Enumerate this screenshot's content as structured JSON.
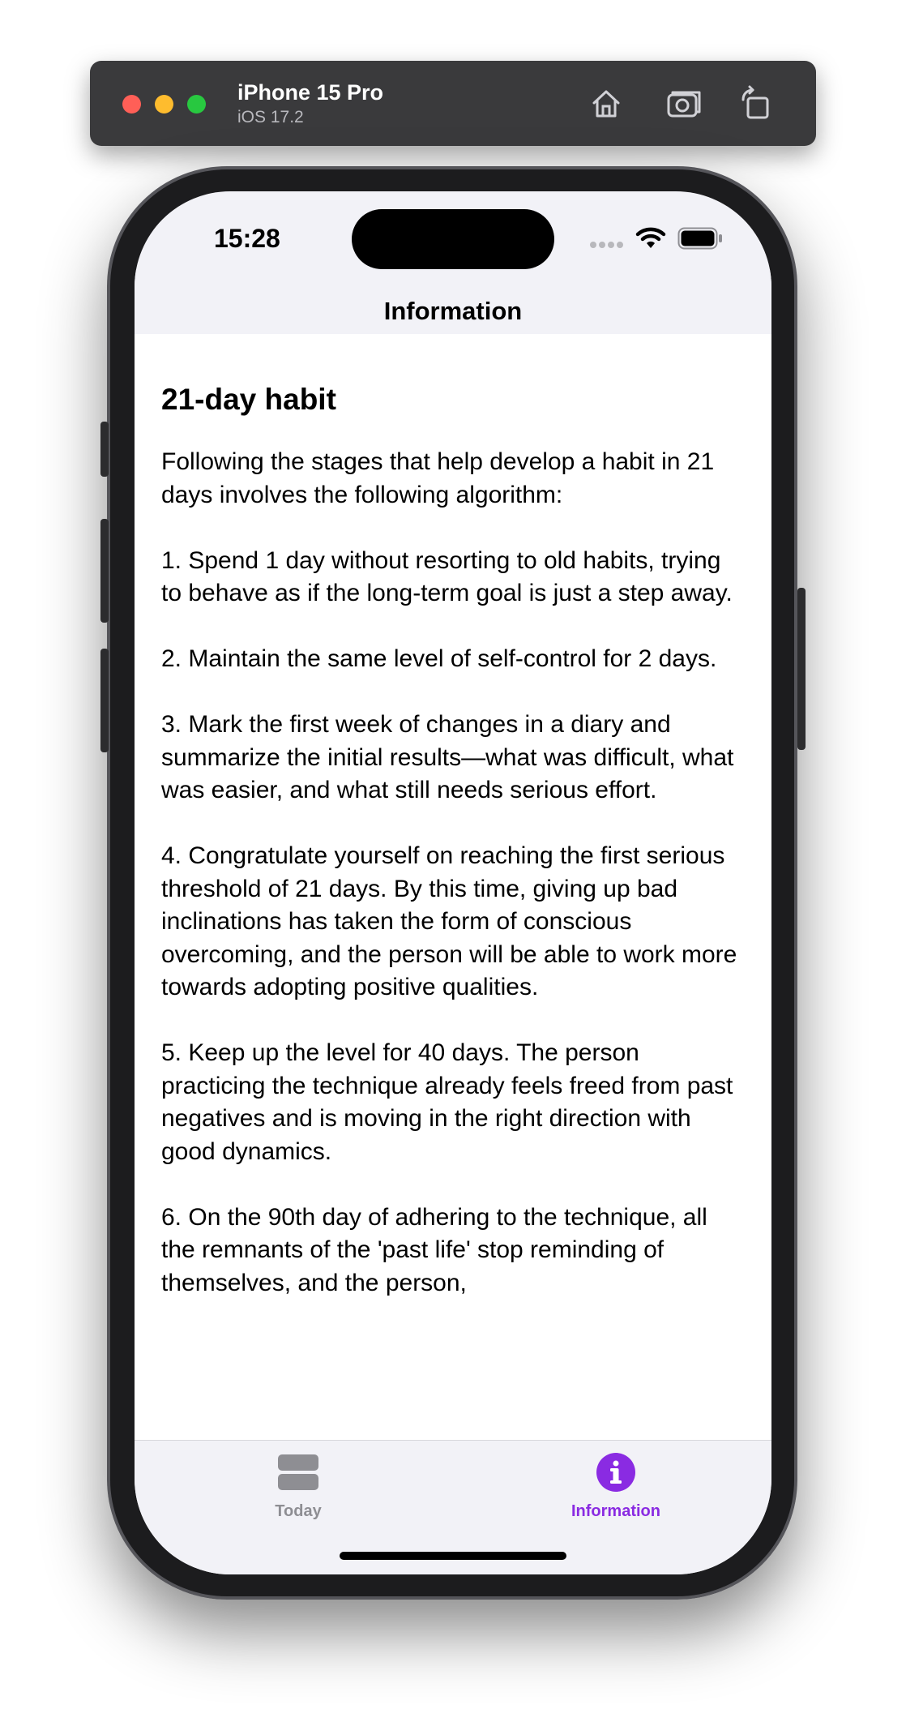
{
  "simulator": {
    "device_name": "iPhone 15 Pro",
    "os_version": "iOS 17.2",
    "toolbar_icons": [
      "home-icon",
      "screenshot-icon",
      "rotate-icon"
    ]
  },
  "status_bar": {
    "time": "15:28"
  },
  "nav": {
    "title": "Information"
  },
  "article": {
    "title": "21-day habit",
    "paragraphs": [
      "Following the stages that help develop a habit in 21 days involves the following algorithm:",
      "1. Spend 1 day without resorting to old habits, trying to behave as if the long-term goal is just a step away.",
      "2. Maintain the same level of self-control for 2 days.",
      "3. Mark the first week of changes in a diary and summarize the initial results—what was difficult, what was easier, and what still needs serious effort.",
      "4. Congratulate yourself on reaching the first serious threshold of 21 days. By this time, giving up bad inclinations has taken the form of conscious overcoming, and the person will be able to work more towards adopting positive qualities.",
      "5. Keep up the level for 40 days. The person practicing the technique already feels freed from past negatives and is moving in the right direction with good dynamics.",
      "6. On the 90th day of adhering to the technique, all the remnants of the 'past life' stop reminding of themselves, and the person,"
    ]
  },
  "tab_bar": {
    "tabs": [
      {
        "label": "Today",
        "icon": "stack-icon",
        "selected": false
      },
      {
        "label": "Information",
        "icon": "info-circle-icon",
        "selected": true
      }
    ]
  },
  "colors": {
    "accent": "#8a2be2",
    "inactive": "#8e8e93",
    "toolbar": "#3a3a3c"
  }
}
